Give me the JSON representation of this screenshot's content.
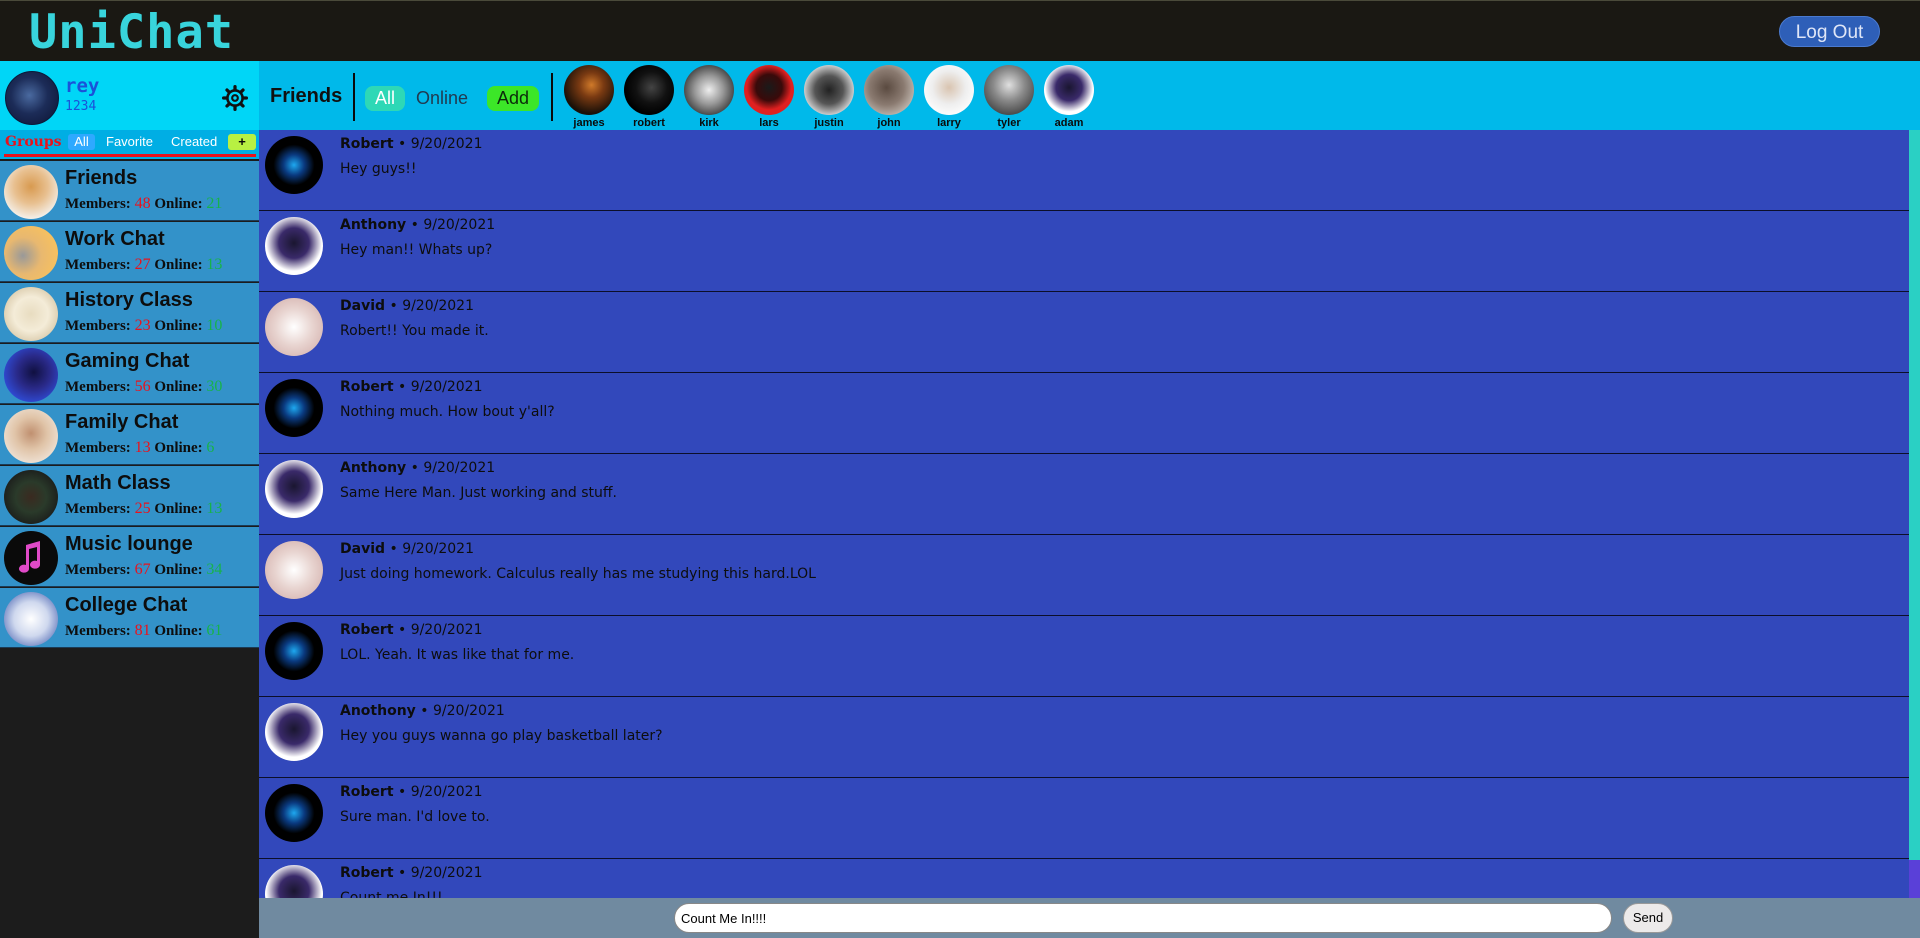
{
  "app": {
    "title": "UniChat",
    "logout_label": "Log Out"
  },
  "user": {
    "name": "rey",
    "id": "1234"
  },
  "friends_bar": {
    "title": "Friends",
    "tabs": {
      "all": "All",
      "online": "Online",
      "add": "Add"
    },
    "friends": [
      {
        "name": "james"
      },
      {
        "name": "robert"
      },
      {
        "name": "kirk"
      },
      {
        "name": "lars"
      },
      {
        "name": "justin"
      },
      {
        "name": "john"
      },
      {
        "name": "larry"
      },
      {
        "name": "tyler"
      },
      {
        "name": "adam"
      }
    ]
  },
  "groups_panel": {
    "label": "Groups",
    "tabs": {
      "all": "All",
      "favorite": "Favorite",
      "created": "Created",
      "add": "+"
    },
    "members_label": "Members:",
    "online_label": "Online:",
    "groups": [
      {
        "name": "Friends",
        "members": "48",
        "online": "21"
      },
      {
        "name": "Work Chat",
        "members": "27",
        "online": "13"
      },
      {
        "name": "History Class",
        "members": "23",
        "online": "10"
      },
      {
        "name": "Gaming Chat",
        "members": "56",
        "online": "30"
      },
      {
        "name": "Family Chat",
        "members": "13",
        "online": "6"
      },
      {
        "name": "Math Class",
        "members": "25",
        "online": "13"
      },
      {
        "name": "Music lounge",
        "members": "67",
        "online": "34"
      },
      {
        "name": "College Chat",
        "members": "81",
        "online": "61"
      }
    ]
  },
  "messages": [
    {
      "author": "Robert",
      "date": "9/20/2021",
      "text": "Hey guys!!"
    },
    {
      "author": "Anthony",
      "date": "9/20/2021",
      "text": "Hey man!! Whats up?"
    },
    {
      "author": "David",
      "date": "9/20/2021",
      "text": "Robert!! You made it."
    },
    {
      "author": "Robert",
      "date": "9/20/2021",
      "text": "Nothing much. How bout y'all?"
    },
    {
      "author": "Anthony",
      "date": "9/20/2021",
      "text": "Same Here Man. Just working and stuff."
    },
    {
      "author": "David",
      "date": "9/20/2021",
      "text": "Just doing homework. Calculus really has me studying this hard.LOL"
    },
    {
      "author": "Robert",
      "date": "9/20/2021",
      "text": "LOL. Yeah. It was like that for me."
    },
    {
      "author": "Anothony",
      "date": "9/20/2021",
      "text": "Hey you guys wanna go play basketball later?"
    },
    {
      "author": "Robert",
      "date": "9/20/2021",
      "text": "Sure man. I'd love to."
    },
    {
      "author": "Robert",
      "date": "9/20/2021",
      "text": "Count me In!!!"
    }
  ],
  "date_separator": " • ",
  "composer": {
    "value": "Count Me In!!!!",
    "send_label": "Send"
  }
}
